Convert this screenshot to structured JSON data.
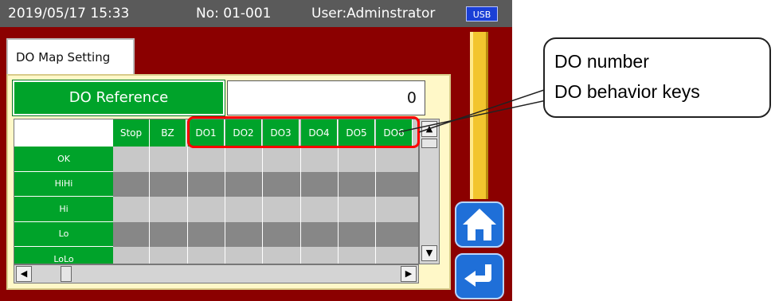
{
  "status_bar": {
    "datetime": "2019/05/17 15:33",
    "number": "No: 01-001",
    "user": "User:Adminstrator",
    "usb_badge": "USB"
  },
  "tab": {
    "label": "DO Map Setting"
  },
  "reference": {
    "button_label": "DO Reference",
    "value": "0"
  },
  "grid": {
    "columns": [
      "Stop",
      "BZ",
      "DO1",
      "DO2",
      "DO3",
      "DO4",
      "DO5",
      "DO6"
    ],
    "rows": [
      "OK",
      "HiHi",
      "Hi",
      "Lo",
      "LoLo"
    ]
  },
  "callout": {
    "line1": "DO number",
    "line2": "DO behavior keys"
  },
  "nav": {
    "home_icon": "home-icon",
    "back_icon": "return-arrow-icon"
  },
  "colors": {
    "accent_green": "#00a32a",
    "frame_red": "#8b0000",
    "highlight_red": "#ff0000",
    "nav_blue": "#1f6fd8"
  }
}
